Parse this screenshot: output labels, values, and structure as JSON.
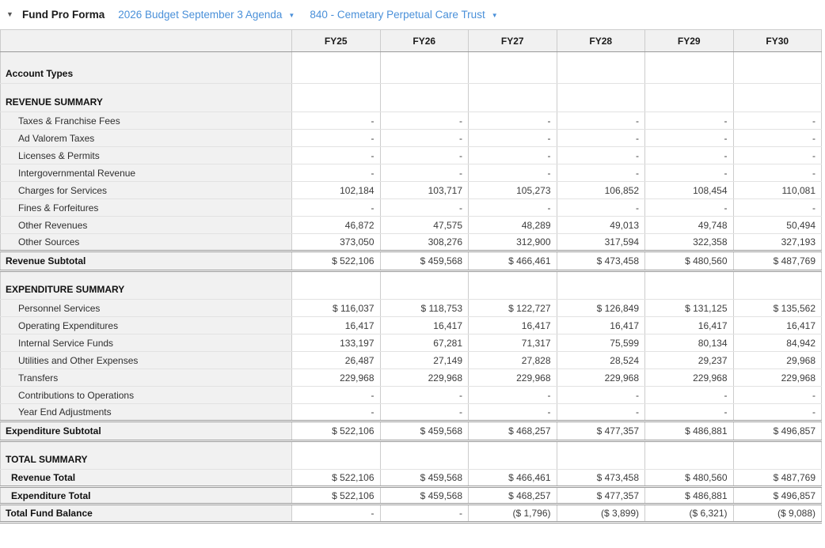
{
  "header": {
    "collapse_icon": "▼",
    "title": "Fund Pro Forma",
    "dropdowns": [
      {
        "label": "2026 Budget September 3 Agenda",
        "arrow": "▼"
      },
      {
        "label": "840 - Cemetary Perpetual Care Trust",
        "arrow": "▼"
      }
    ]
  },
  "colors": {
    "accent_blue": "#4a90d9",
    "header_bg": "#f1f1f1",
    "label_column_bg": "#f1f1f1"
  },
  "table": {
    "corner_header": "",
    "columns": [
      "FY25",
      "FY26",
      "FY27",
      "FY28",
      "FY29",
      "FY30"
    ],
    "rows": [
      {
        "label": "Account Types",
        "type": "section",
        "values": [
          "",
          "",
          "",
          "",
          "",
          ""
        ]
      },
      {
        "label": "REVENUE SUMMARY",
        "type": "section",
        "values": [
          "",
          "",
          "",
          "",
          "",
          ""
        ]
      },
      {
        "label": "Taxes & Franchise Fees",
        "type": "detail",
        "values": [
          "-",
          "-",
          "-",
          "-",
          "-",
          "-"
        ]
      },
      {
        "label": "Ad Valorem Taxes",
        "type": "detail",
        "values": [
          "-",
          "-",
          "-",
          "-",
          "-",
          "-"
        ]
      },
      {
        "label": "Licenses & Permits",
        "type": "detail",
        "values": [
          "-",
          "-",
          "-",
          "-",
          "-",
          "-"
        ]
      },
      {
        "label": "Intergovernmental Revenue",
        "type": "detail",
        "values": [
          "-",
          "-",
          "-",
          "-",
          "-",
          "-"
        ]
      },
      {
        "label": "Charges for Services",
        "type": "detail",
        "values": [
          "102,184",
          "103,717",
          "105,273",
          "106,852",
          "108,454",
          "110,081"
        ]
      },
      {
        "label": "Fines & Forfeitures",
        "type": "detail",
        "values": [
          "-",
          "-",
          "-",
          "-",
          "-",
          "-"
        ]
      },
      {
        "label": "Other Revenues",
        "type": "detail",
        "values": [
          "46,872",
          "47,575",
          "48,289",
          "49,013",
          "49,748",
          "50,494"
        ]
      },
      {
        "label": "Other Sources",
        "type": "detail",
        "values": [
          "373,050",
          "308,276",
          "312,900",
          "317,594",
          "322,358",
          "327,193"
        ]
      },
      {
        "label": "Revenue Subtotal",
        "type": "subtotal",
        "values": [
          "$ 522,106",
          "$ 459,568",
          "$ 466,461",
          "$ 473,458",
          "$ 480,560",
          "$ 487,769"
        ]
      },
      {
        "label": "EXPENDITURE SUMMARY",
        "type": "section",
        "values": [
          "",
          "",
          "",
          "",
          "",
          ""
        ]
      },
      {
        "label": "Personnel Services",
        "type": "detail",
        "values": [
          "$ 116,037",
          "$ 118,753",
          "$ 122,727",
          "$ 126,849",
          "$ 131,125",
          "$ 135,562"
        ]
      },
      {
        "label": "Operating Expenditures",
        "type": "detail",
        "values": [
          "16,417",
          "16,417",
          "16,417",
          "16,417",
          "16,417",
          "16,417"
        ]
      },
      {
        "label": "Internal Service Funds",
        "type": "detail",
        "values": [
          "133,197",
          "67,281",
          "71,317",
          "75,599",
          "80,134",
          "84,942"
        ]
      },
      {
        "label": "Utilities and Other Expenses",
        "type": "detail",
        "values": [
          "26,487",
          "27,149",
          "27,828",
          "28,524",
          "29,237",
          "29,968"
        ]
      },
      {
        "label": "Transfers",
        "type": "detail",
        "values": [
          "229,968",
          "229,968",
          "229,968",
          "229,968",
          "229,968",
          "229,968"
        ]
      },
      {
        "label": "Contributions to Operations",
        "type": "detail",
        "values": [
          "-",
          "-",
          "-",
          "-",
          "-",
          "-"
        ]
      },
      {
        "label": "Year End Adjustments",
        "type": "detail",
        "values": [
          "-",
          "-",
          "-",
          "-",
          "-",
          "-"
        ]
      },
      {
        "label": "Expenditure Subtotal",
        "type": "subtotal",
        "values": [
          "$ 522,106",
          "$ 459,568",
          "$ 468,257",
          "$ 477,357",
          "$ 486,881",
          "$ 496,857"
        ]
      },
      {
        "label": "TOTAL SUMMARY",
        "type": "section",
        "values": [
          "",
          "",
          "",
          "",
          "",
          ""
        ]
      },
      {
        "label": "Revenue Total",
        "type": "total",
        "values": [
          "$ 522,106",
          "$ 459,568",
          "$ 466,461",
          "$ 473,458",
          "$ 480,560",
          "$ 487,769"
        ]
      },
      {
        "label": "Expenditure Total",
        "type": "total",
        "values": [
          "$ 522,106",
          "$ 459,568",
          "$ 468,257",
          "$ 477,357",
          "$ 486,881",
          "$ 496,857"
        ]
      },
      {
        "label": "Total Fund Balance",
        "type": "grand",
        "values": [
          "-",
          "-",
          "($ 1,796)",
          "($ 3,899)",
          "($ 6,321)",
          "($ 9,088)"
        ]
      }
    ]
  }
}
